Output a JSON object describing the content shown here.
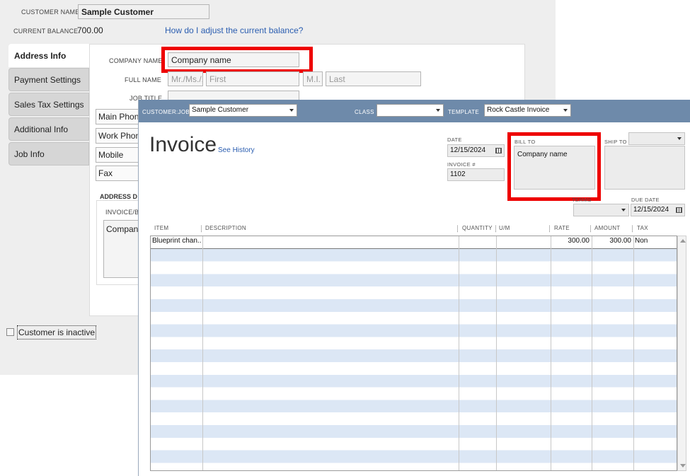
{
  "customer": {
    "name_label": "CUSTOMER NAME",
    "name_value": "Sample Customer",
    "balance_label": "CURRENT BALANCE",
    "balance_value": "700.00",
    "adjust_link": "How do I adjust the current balance?",
    "tabs": [
      {
        "label": "Address Info"
      },
      {
        "label": "Payment Settings"
      },
      {
        "label": "Sales Tax Settings"
      },
      {
        "label": "Additional Info"
      },
      {
        "label": "Job Info"
      }
    ],
    "company_label": "COMPANY NAME",
    "company_value": "Company name",
    "fullname_label": "FULL NAME",
    "fullname": {
      "prefix": "Mr./Ms./...",
      "first": "First",
      "mi": "M.I.",
      "last": "Last"
    },
    "jobtitle_label": "JOB TITLE",
    "phones": [
      "Main Phone",
      "Work Phone",
      "Mobile",
      "Fax"
    ],
    "address_section": "ADDRESS D",
    "invoice_bill_label": "INVOICE/B",
    "address_value": "Compan",
    "inactive_label": "Customer is inactive"
  },
  "invoice": {
    "customer_job_label": "CUSTOMER:JOB",
    "customer_job_value": "Sample Customer",
    "class_label": "CLASS",
    "class_value": "",
    "template_label": "TEMPLATE",
    "template_value": "Rock Castle Invoice",
    "title": "Invoice",
    "see_history": "See History",
    "date_label": "DATE",
    "date_value": "12/15/2024",
    "invoice_no_label": "INVOICE #",
    "invoice_no_value": "1102",
    "bill_to_label": "BILL TO",
    "bill_to_value": "Company name",
    "ship_to_label": "SHIP TO",
    "terms_label": "TERMS",
    "due_date_label": "DUE DATE",
    "due_date_value": "12/15/2024",
    "columns": [
      "ITEM",
      "DESCRIPTION",
      "QUANTITY",
      "U/M",
      "RATE",
      "AMOUNT",
      "TAX"
    ],
    "rows": [
      {
        "item": "Blueprint chan...",
        "description": "",
        "quantity": "",
        "um": "",
        "rate": "300.00",
        "amount": "300.00",
        "tax": "Non"
      }
    ]
  }
}
